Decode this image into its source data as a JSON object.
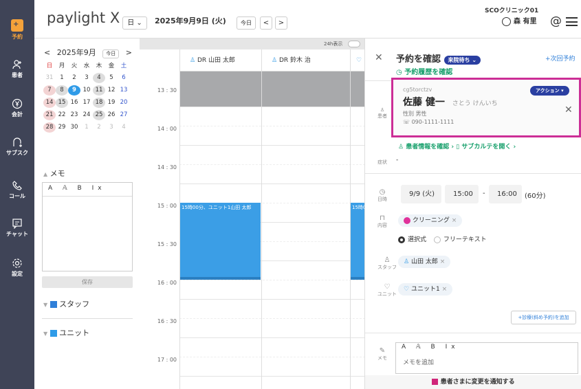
{
  "sidebar": {
    "items": [
      {
        "label": "予約",
        "icon": "calendar-icon"
      },
      {
        "label": "患者",
        "icon": "user-add-icon"
      },
      {
        "label": "会計",
        "icon": "yen-icon"
      },
      {
        "label": "サブスク",
        "icon": "subscription-icon"
      },
      {
        "label": "コール",
        "icon": "phone-icon"
      },
      {
        "label": "チャット",
        "icon": "chat-icon"
      },
      {
        "label": "設定",
        "icon": "gear-icon"
      }
    ]
  },
  "header": {
    "logo": "paylight X",
    "view_select": "日",
    "date": "2025年9月9日 (火)",
    "today": "今日",
    "prev": "<",
    "next": ">",
    "clinic": "SCOクリニック01",
    "user": "森 有里",
    "at_icon": "@",
    "menu_icon": "hamburger-icon"
  },
  "mini_calendar": {
    "month": "2025年9月",
    "today_btn": "今日",
    "weekdays": [
      "日",
      "月",
      "火",
      "水",
      "木",
      "金",
      "土"
    ],
    "weeks": [
      [
        "31",
        "1",
        "2",
        "3",
        "4",
        "5",
        "6"
      ],
      [
        "7",
        "8",
        "9",
        "10",
        "11",
        "12",
        "13"
      ],
      [
        "14",
        "15",
        "16",
        "17",
        "18",
        "19",
        "20"
      ],
      [
        "21",
        "22",
        "23",
        "24",
        "25",
        "26",
        "27"
      ],
      [
        "28",
        "29",
        "30",
        "1",
        "2",
        "3",
        "4"
      ]
    ]
  },
  "memo": {
    "title": "メモ",
    "toolbar": "A 𝔸 B Ix",
    "save": "保存"
  },
  "filters": {
    "staff": "スタッフ",
    "unit": "ユニット"
  },
  "schedule": {
    "toggle_24h": "24h表示",
    "columns": [
      "DR 山田 太郎",
      "DR 鈴木 治"
    ],
    "times": [
      "13 : 30",
      "14 : 00",
      "14 : 30",
      "15 : 00",
      "15 : 30",
      "16 : 00",
      "16 : 30",
      "17 : 00"
    ],
    "appointment": "15時00分、ユニット1山田 太郎",
    "appointment_clip": "15時0"
  },
  "panel": {
    "title": "予約を確認",
    "status": "来院待ち",
    "history": "予約履歴を確認",
    "next": "+次回予約",
    "patient_label": "患者",
    "patient_id": "cg5torctzv",
    "action": "アクション",
    "name": "佐藤 健一",
    "kana": "さとう けんいち",
    "sex": "性別 男性",
    "phone": "090-1111-1111",
    "patient_info_link": "患者情報を確認",
    "subchart_link": "サブカルテを開く",
    "symptom_label": "症状",
    "symptom_value": "-",
    "date_label": "日時",
    "date": "9/9 (火)",
    "start": "15:00",
    "dash": "-",
    "end": "16:00",
    "duration": "(60分)",
    "content_label": "内容",
    "content_chip": "クリーニング",
    "radio1": "選択式",
    "radio2": "フリーテキスト",
    "staff_label": "スタッフ",
    "staff_chip": "山田 太郎",
    "unit_label": "ユニット",
    "unit_chip": "ユニット1",
    "add_btn": "+診療(斜め予約)を追加",
    "memo_label": "メモ",
    "memo_toolbar": "A 𝔸 B Ix",
    "memo_placeholder": "メモを追加",
    "notify": "患者さまに変更を通知する"
  }
}
